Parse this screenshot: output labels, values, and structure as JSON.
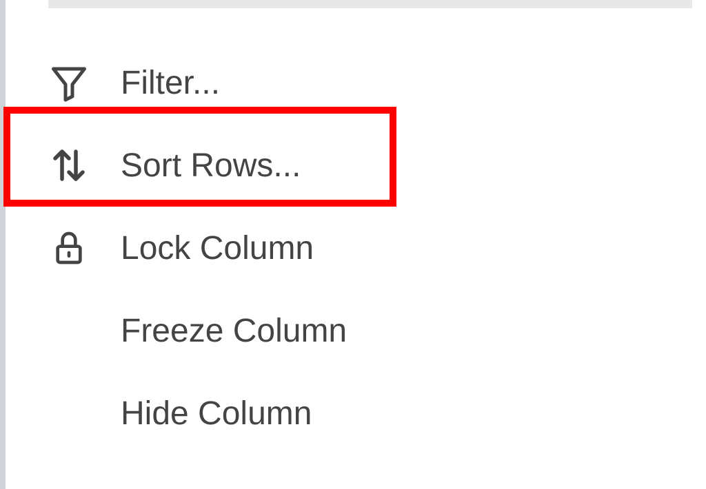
{
  "menu": {
    "items": [
      {
        "label": "Filter...",
        "icon": "filter-icon"
      },
      {
        "label": "Sort Rows...",
        "icon": "sort-icon"
      },
      {
        "label": "Lock Column",
        "icon": "lock-icon"
      },
      {
        "label": "Freeze Column",
        "icon": ""
      },
      {
        "label": "Hide Column",
        "icon": ""
      }
    ]
  },
  "highlight": {
    "index": 1,
    "color": "#ff0000"
  }
}
